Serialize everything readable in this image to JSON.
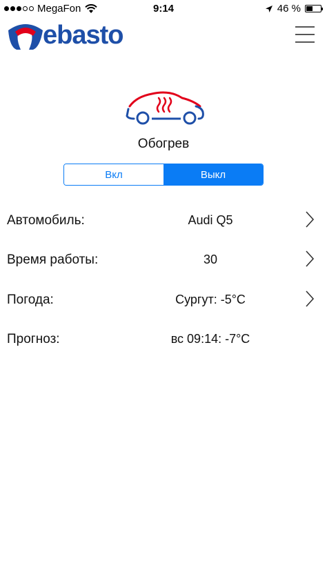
{
  "status_bar": {
    "carrier": "MegaFon",
    "time": "9:14",
    "battery_percent": "46 %",
    "battery_level": 0.46,
    "signal_bars_filled": 3,
    "signal_bars_total": 5
  },
  "header": {
    "logo_text": "ebasto",
    "brand_blue": "#1e4fa8",
    "brand_red": "#e2001a"
  },
  "mode": {
    "title": "Обогрев",
    "on_label": "Вкл",
    "off_label": "Выкл",
    "selected": "off",
    "accent": "#0a7cf5"
  },
  "rows": [
    {
      "label": "Автомобиль:",
      "value": "Audi Q5",
      "has_chevron": true
    },
    {
      "label": "Время работы:",
      "value": "30",
      "has_chevron": true
    },
    {
      "label": "Погода:",
      "value": "Сургут: -5°C",
      "has_chevron": true
    },
    {
      "label": "Прогноз:",
      "value": "вс 09:14: -7°C",
      "has_chevron": false
    }
  ],
  "icons": {
    "menu": "hamburger-icon",
    "car": "car-heating-icon",
    "chevron": "chevron-right-icon",
    "location": "location-arrow-icon",
    "wifi": "wifi-icon"
  }
}
